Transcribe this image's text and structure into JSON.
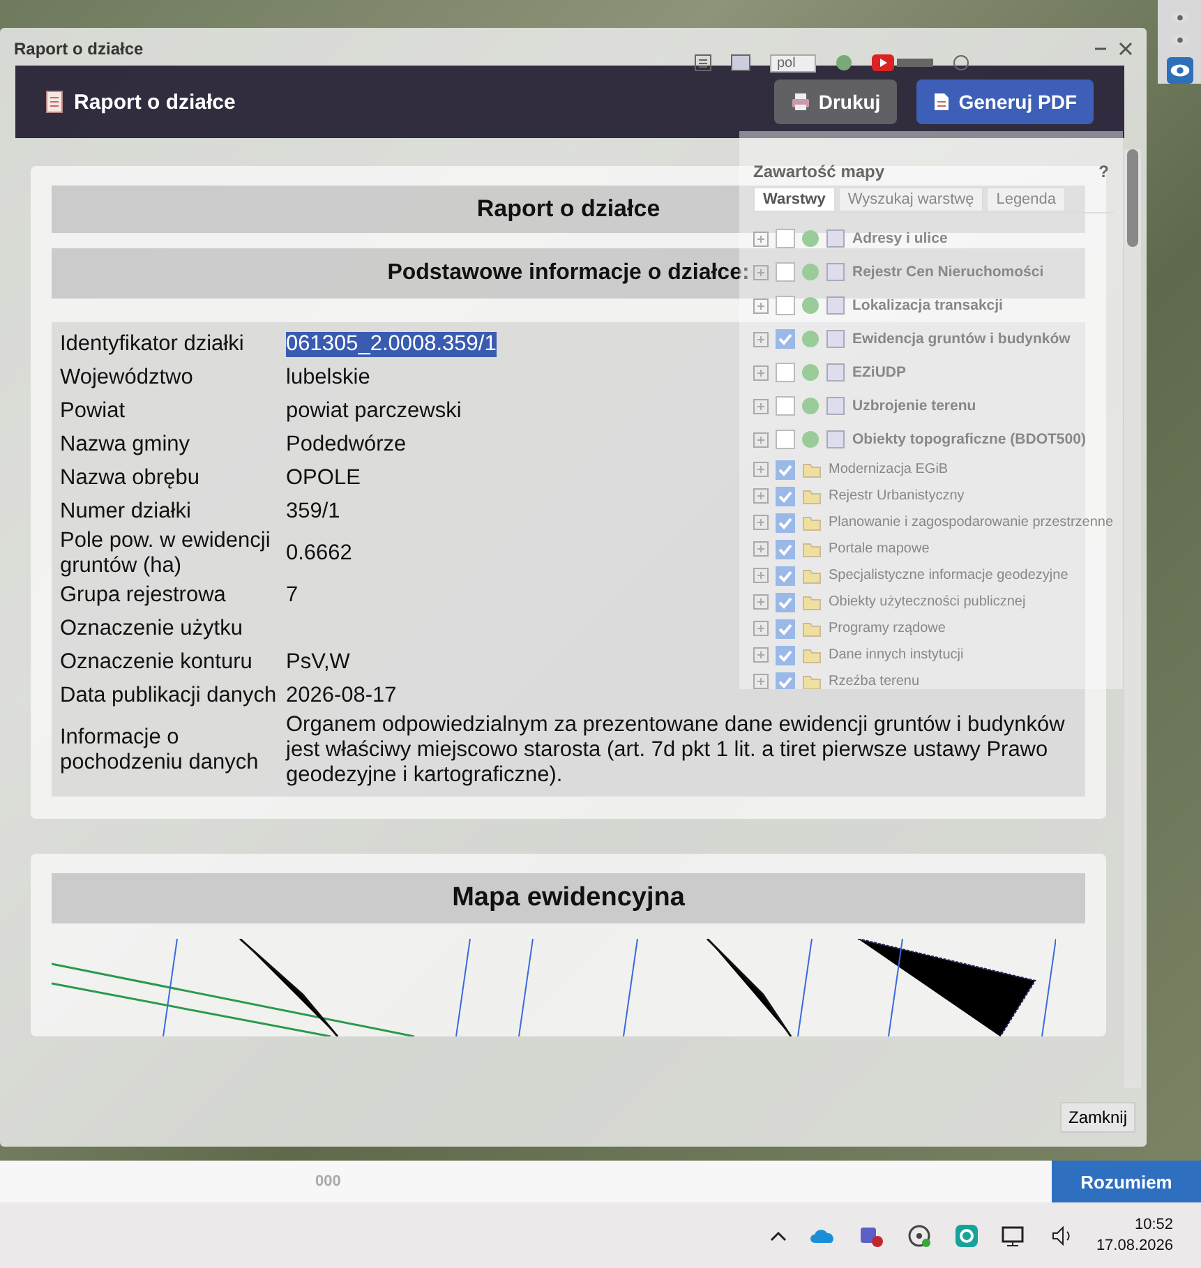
{
  "layers_panel": {
    "language": "pol",
    "title": "Zawartość mapy",
    "help": "?",
    "tabs": [
      {
        "label": "Warstwy",
        "selected": true
      },
      {
        "label": "Wyszukaj warstwę",
        "selected": false
      },
      {
        "label": "Legenda",
        "selected": false
      }
    ],
    "layers": [
      {
        "kind": "service",
        "label": "Adresy i ulice",
        "checked": false
      },
      {
        "kind": "service",
        "label": "Rejestr Cen Nieruchomości",
        "checked": false
      },
      {
        "kind": "service",
        "label": "Lokalizacja transakcji",
        "checked": false
      },
      {
        "kind": "service",
        "label": "Ewidencja gruntów i budynków",
        "checked": true
      },
      {
        "kind": "service",
        "label": "EZiUDP",
        "checked": false
      },
      {
        "kind": "service",
        "label": "Uzbrojenie terenu",
        "checked": false
      },
      {
        "kind": "service",
        "label": "Obiekty topograficzne (BDOT500)",
        "checked": false
      },
      {
        "kind": "group",
        "label": "Modernizacja EGiB",
        "checked": true
      },
      {
        "kind": "group",
        "label": "Rejestr Urbanistyczny",
        "checked": true
      },
      {
        "kind": "group",
        "label": "Planowanie i zagospodarowanie przestrzenne",
        "checked": true
      },
      {
        "kind": "group",
        "label": "Portale mapowe",
        "checked": true
      },
      {
        "kind": "group",
        "label": "Specjalistyczne informacje geodezyjne",
        "checked": true
      },
      {
        "kind": "group",
        "label": "Obiekty użyteczności publicznej",
        "checked": true
      },
      {
        "kind": "group",
        "label": "Programy rządowe",
        "checked": true
      },
      {
        "kind": "group",
        "label": "Dane innych instytucji",
        "checked": true
      },
      {
        "kind": "group",
        "label": "Rzeźba terenu",
        "checked": true
      }
    ]
  },
  "dialog": {
    "title": "Raport o działce",
    "header_title": "Raport o działce",
    "buttons": [
      {
        "kind": "print",
        "label": "Drukuj"
      },
      {
        "kind": "pdf",
        "label": "Generuj PDF"
      }
    ],
    "report_title": "Raport o działce",
    "section_title": "Podstawowe informacje o działce:",
    "rows": [
      {
        "label": "Identyfikator działki",
        "value": "061305_2.0008.359/1",
        "highlighted": true
      },
      {
        "label": "Województwo",
        "value": "lubelskie",
        "highlighted": false
      },
      {
        "label": "Powiat",
        "value": "powiat parczewski",
        "highlighted": false
      },
      {
        "label": "Nazwa gminy",
        "value": "Podedwórze",
        "highlighted": false
      },
      {
        "label": "Nazwa obrębu",
        "value": "OPOLE",
        "highlighted": false
      },
      {
        "label": "Numer działki",
        "value": "359/1",
        "highlighted": false
      },
      {
        "label": "Pole pow. w ewidencji gruntów (ha)",
        "value": "0.6662",
        "highlighted": false
      },
      {
        "label": "Grupa rejestrowa",
        "value": "7",
        "highlighted": false
      },
      {
        "label": "Oznaczenie użytku",
        "value": "",
        "highlighted": false
      },
      {
        "label": "Oznaczenie konturu",
        "value": "PsV,W",
        "highlighted": false
      },
      {
        "label": "Data publikacji danych",
        "value": "2026-08-17",
        "highlighted": false
      },
      {
        "label": "Informacje o pochodzeniu danych",
        "value": "Organem odpowiedzialnym za prezentowane dane ewidencji gruntów i budynków jest właściwy miejscowo starosta (art. 7d pkt 1 lit. a tiret pierwsze ustawy Prawo geodezyjne i kartograficzne).",
        "highlighted": false
      }
    ],
    "map_title": "Mapa ewidencyjna",
    "close_button": "Zamknij"
  },
  "status_bar": {
    "scale": "000",
    "accept_button": "Rozumiem"
  },
  "taskbar": {
    "time": "10:52",
    "date": "17.08.2026"
  }
}
